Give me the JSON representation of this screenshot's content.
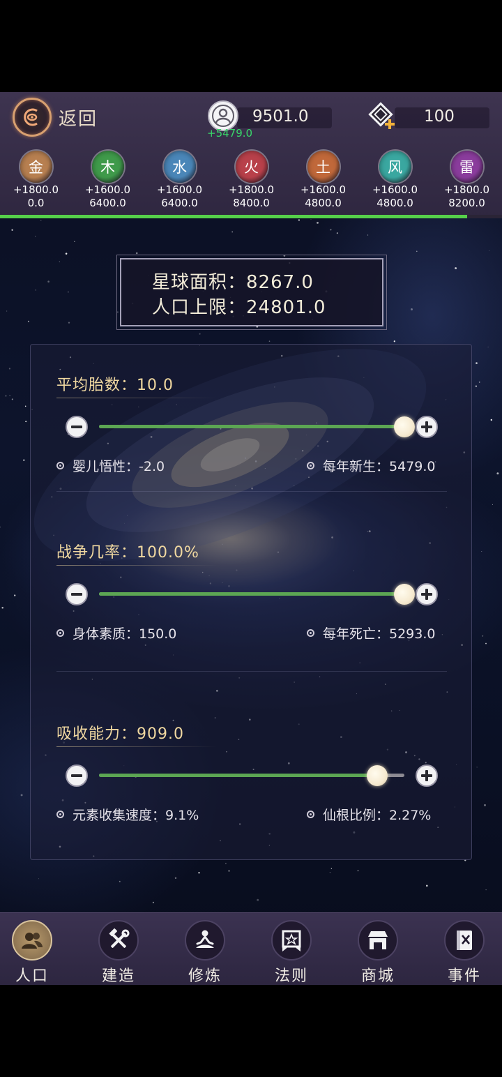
{
  "header": {
    "back_label": "返回",
    "population": {
      "value": "9501.0",
      "delta": "+5479.0",
      "icon": "population-icon"
    },
    "gem": {
      "value": "100",
      "icon": "gem-plus-icon"
    },
    "progress_fraction": 0.93
  },
  "elements": [
    {
      "glyph": "金",
      "rate": "+1800.0",
      "total": "0.0",
      "color": "#b77f50"
    },
    {
      "glyph": "木",
      "rate": "+1600.0",
      "total": "6400.0",
      "color": "#3f9a4a"
    },
    {
      "glyph": "水",
      "rate": "+1600.0",
      "total": "6400.0",
      "color": "#4a86b8"
    },
    {
      "glyph": "火",
      "rate": "+1800.0",
      "total": "8400.0",
      "color": "#b8404a"
    },
    {
      "glyph": "土",
      "rate": "+1600.0",
      "total": "4800.0",
      "color": "#c0683a"
    },
    {
      "glyph": "风",
      "rate": "+1600.0",
      "total": "4800.0",
      "color": "#3aa7a0"
    },
    {
      "glyph": "雷",
      "rate": "+1800.0",
      "total": "8200.0",
      "color": "#8a3c9c"
    }
  ],
  "planet": {
    "area": "星球面积：8267.0",
    "population_cap": "人口上限：24801.0"
  },
  "sliders": [
    {
      "title": "平均胎数：10.0",
      "level": 1.0,
      "left_stat": "婴儿悟性：-2.0",
      "right_stat": "每年新生：5479.0"
    },
    {
      "title": "战争几率：100.0%",
      "level": 1.0,
      "left_stat": "身体素质：150.0",
      "right_stat": "每年死亡：5293.0"
    },
    {
      "title": "吸收能力：909.0",
      "level": 0.91,
      "left_stat": "元素收集速度：9.1%",
      "right_stat": "仙根比例：2.27%"
    }
  ],
  "nav": [
    {
      "label": "人口",
      "icon": "people-icon",
      "active": true
    },
    {
      "label": "建造",
      "icon": "tools-icon",
      "active": false
    },
    {
      "label": "修炼",
      "icon": "meditation-icon",
      "active": false
    },
    {
      "label": "法则",
      "icon": "law-banner-icon",
      "active": false
    },
    {
      "label": "商城",
      "icon": "shop-icon",
      "active": false
    },
    {
      "label": "事件",
      "icon": "event-book-icon",
      "active": false
    }
  ]
}
